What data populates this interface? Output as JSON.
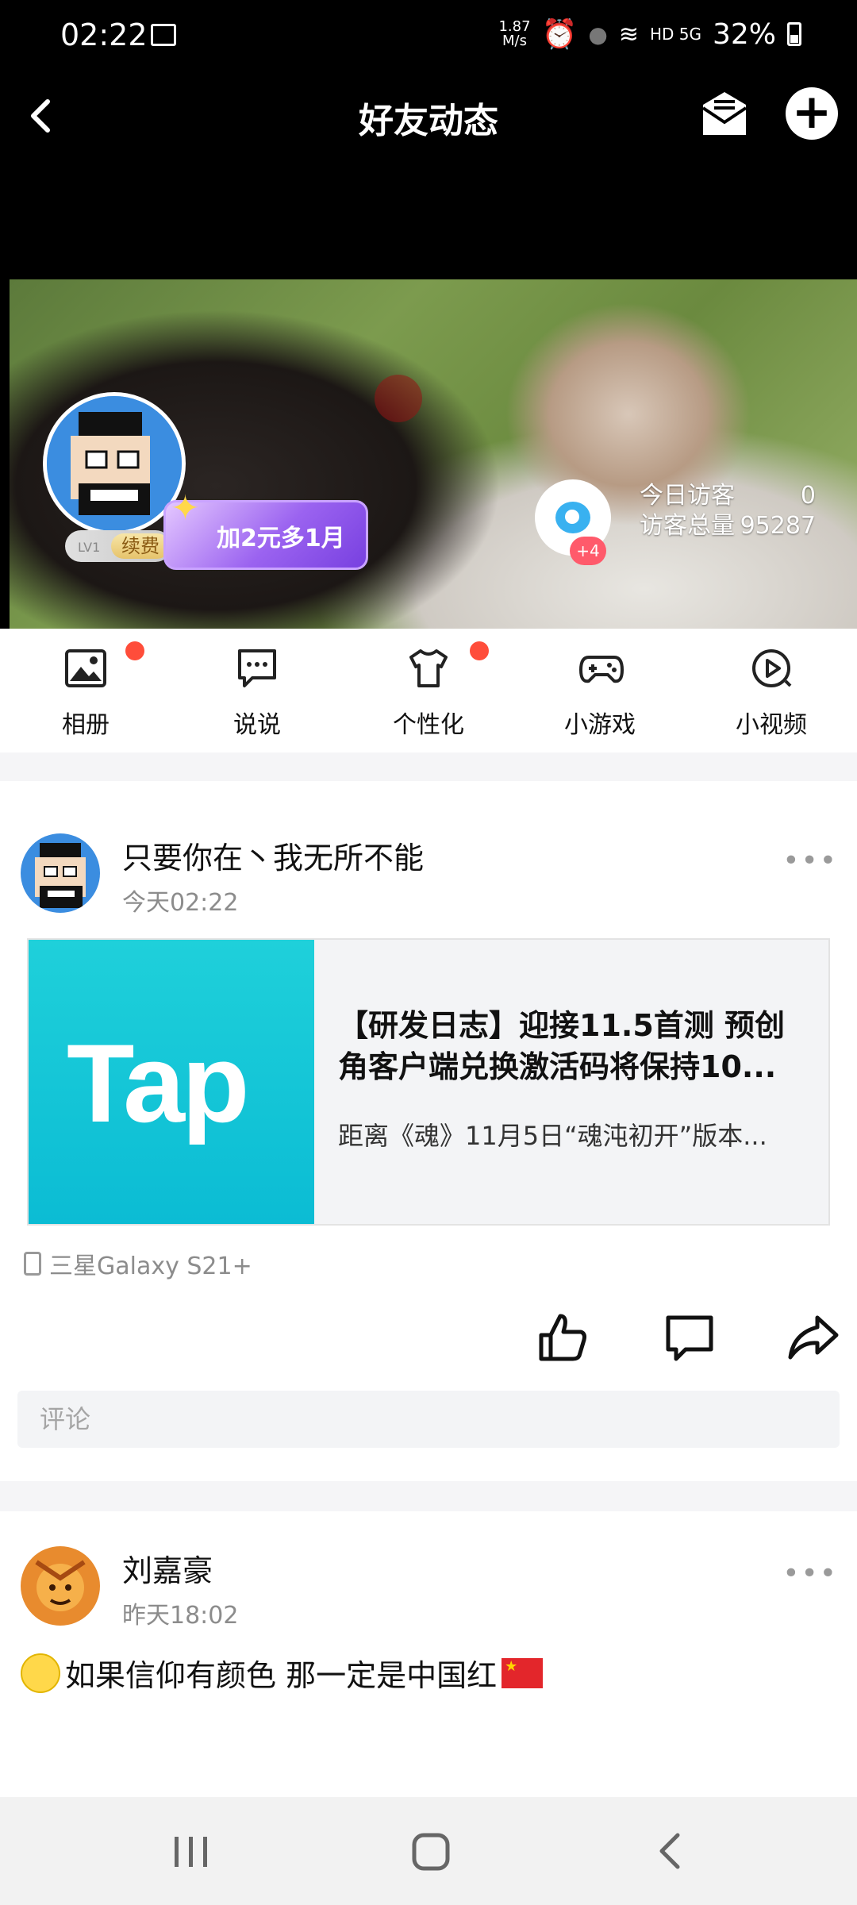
{
  "status_bar": {
    "time": "02:22",
    "net_speed_top": "1.87",
    "net_speed_bottom": "M/s",
    "network": "HD 5G",
    "battery": "32%"
  },
  "nav": {
    "title": "好友动态",
    "back_icon": "chevron-left-icon",
    "mail_icon": "mail-icon",
    "add_icon": "plus-icon"
  },
  "profile": {
    "level": "LV1",
    "renew_label": "续费",
    "promo_label": "加2元多1月",
    "visitor_plus": "+4",
    "today_visitors_label": "今日访客",
    "today_visitors_value": "0",
    "total_visitors_label": "访客总量",
    "total_visitors_value": "95287"
  },
  "shortcuts": [
    {
      "label": "相册",
      "icon": "photo-album-icon",
      "dot": true
    },
    {
      "label": "说说",
      "icon": "chat-bubble-icon",
      "dot": false
    },
    {
      "label": "个性化",
      "icon": "tshirt-icon",
      "dot": true
    },
    {
      "label": "小游戏",
      "icon": "gamepad-icon",
      "dot": false
    },
    {
      "label": "小视频",
      "icon": "play-circle-icon",
      "dot": false
    }
  ],
  "posts": [
    {
      "author": "只要你在丶我无所不能",
      "time": "今天02:22",
      "more": "•••",
      "card": {
        "thumb_text": "Tap",
        "title": "【研发日志】迎接11.5首测 预创角客户端兑换激活码将保持10...",
        "desc": "距离《魂》11月5日“魂沌初开”版本..."
      },
      "device": "三星Galaxy S21+",
      "comment_placeholder": "评论"
    },
    {
      "author": "刘嘉豪",
      "time": "昨天18:02",
      "more": "•••",
      "text": "如果信仰有颜色   那一定是中国红"
    }
  ],
  "colors": {
    "accent_red": "#ff4d3a",
    "tap_cyan": "#0bbcd4",
    "promo_purple": "#9b63f0"
  }
}
